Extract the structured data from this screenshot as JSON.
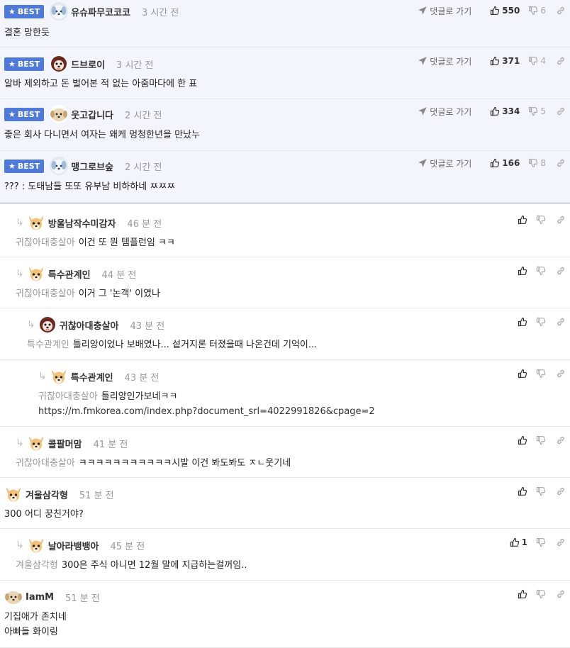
{
  "best_label": "BEST",
  "reply_label": "댓글로 가기",
  "best_comments": [
    {
      "nick": "유슈파무코코코",
      "time": "3 시간 전",
      "text": "결혼 망한듯",
      "likes": "550",
      "dislikes": "6",
      "avatar": "blue-dog"
    },
    {
      "nick": "드브로이",
      "time": "3 시간 전",
      "text": "알바 제외하고 돈 벌어본 적 없는 아줌마다에 한 표",
      "likes": "371",
      "dislikes": "4",
      "avatar": "red-pom"
    },
    {
      "nick": "웃고갑니다",
      "time": "2 시간 전",
      "text": "좋은 회사 다니면서 여자는 왜케 멍청한년을 만났누",
      "likes": "334",
      "dislikes": "5",
      "avatar": "beige-dog"
    },
    {
      "nick": "맹그로브숲",
      "time": "2 시간 전",
      "text": "??? : 도태남들 또또 유부남 비하하네 ㅉㅉㅉ",
      "likes": "166",
      "dislikes": "8",
      "avatar": "blue-dog"
    }
  ],
  "comments": [
    {
      "nick": "방울남작수미감자",
      "time": "46 분 전",
      "parent": "귀찮아대충살아",
      "text": "이건 또 뭔 템플런임 ㅋㅋ",
      "likes": "",
      "avatar": "chihuahua"
    },
    {
      "nick": "특수관계인",
      "time": "44 분 전",
      "parent": "귀찮아대충살아",
      "text": "이거 그 '논객' 이였나",
      "likes": "",
      "avatar": "chihuahua"
    },
    {
      "nick": "귀찮아대충살아",
      "time": "43 분 전",
      "parent": "특수관계인",
      "text": "틀리앙이었나 보배였나... 섵거지론 터졌을때 나온건데 기억이...",
      "likes": "",
      "avatar": "red-pom"
    },
    {
      "nick": "특수관계인",
      "time": "43 분 전",
      "parent": "귀찮아대충살아",
      "text": "틀리앙인가보네ㅋㅋ",
      "link": "https://m.fmkorea.com/index.php?document_srl=4022991826&cpage=2",
      "likes": "",
      "avatar": "chihuahua"
    },
    {
      "nick": "콜팔머맘",
      "time": "41 분 전",
      "parent": "귀찮아대충살아",
      "text": "ㅋㅋㅋㅋㅋㅋㅋㅋㅋㅋㅋ시발 이건 봐도봐도 ㅈㄴ웃기네",
      "likes": "",
      "avatar": "chihuahua"
    },
    {
      "nick": "겨울삼각형",
      "time": "51 분 전",
      "parent": "",
      "text": "300 어디 꿍친거야?",
      "likes": "",
      "avatar": "chihuahua"
    },
    {
      "nick": "날아라뱅뱅아",
      "time": "45 분 전",
      "parent": "겨울삼각형",
      "text": "300은 주식 아니면 12월 말에 지급하는걸꺼임..",
      "likes": "1",
      "avatar": "chihuahua"
    },
    {
      "nick": "IamM",
      "time": "51 분 전",
      "parent": "",
      "text": "기집애가 존치네",
      "text2": "아빠들 화이링",
      "likes": "",
      "avatar": "beige-dog"
    }
  ]
}
